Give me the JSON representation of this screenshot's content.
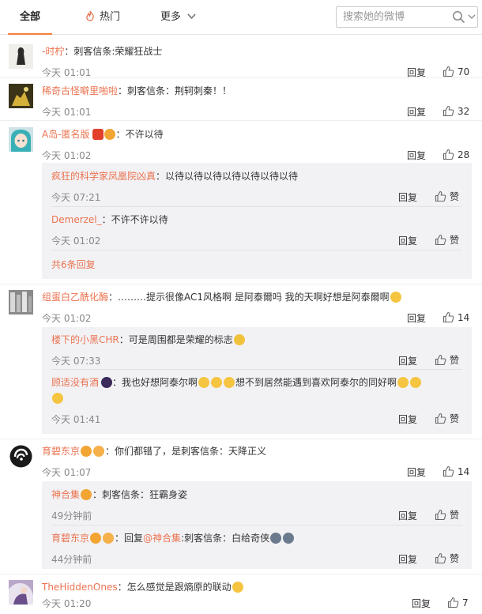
{
  "tabs": {
    "all": "全部",
    "hot": "热门",
    "more": "更多"
  },
  "search": {
    "placeholder": "搜索她的微博"
  },
  "comments": [
    {
      "user": "-时柠",
      "text": "刺客信条:荣耀狂战士",
      "time": "今天 01:01",
      "reply": "回复",
      "likes": "70"
    },
    {
      "user": "稀奇古怪噼里啪啦",
      "text": "刺客信条：荆轲刺秦！！",
      "time": "今天 01:01",
      "reply": "回复",
      "likes": "32"
    },
    {
      "user": "A岛-匿名版",
      "text": "不许以待",
      "time": "今天 01:02",
      "reply": "回复",
      "likes": "28",
      "subs": [
        {
          "user": "疯狂的科学家凤凰院凶真",
          "text": "以待以待以待以待以待以待以待",
          "time": "今天 07:21",
          "reply": "回复",
          "like_label": "赞"
        },
        {
          "user": "Demerzel_",
          "text": "不许不许以待",
          "time": "今天 01:02",
          "reply": "回复",
          "like_label": "赞"
        }
      ],
      "more": "共6条回复"
    },
    {
      "user": "组蛋白乙酰化酶",
      "text": "………提示很像AC1风格啊  是阿泰爾吗 我的天啊好想是阿泰爾啊",
      "time": "今天 01:02",
      "reply": "回复",
      "likes": "14",
      "subs": [
        {
          "user": "楼下的小黑CHR",
          "text": "可是周围都是荣耀的标志",
          "time": "今天 07:33",
          "reply": "回复",
          "like_label": "赞"
        },
        {
          "user": "顾适没有酒",
          "text": "我也好想阿泰尔啊",
          "text2": "想不到居然能遇到喜欢阿泰尔的同好啊",
          "time": "今天 01:41",
          "reply": "回复",
          "like_label": "赞"
        }
      ]
    },
    {
      "user": "育碧东京",
      "text": "你们都错了，是刺客信条：天降正义",
      "time": "今天 01:07",
      "reply": "回复",
      "likes": "14",
      "subs": [
        {
          "user": "神合集",
          "text": "刺客信条：狂霸身姿",
          "time": "49分钟前",
          "reply": "回复",
          "like_label": "赞"
        },
        {
          "user": "育碧东京",
          "text_prefix": "回复",
          "mention": "@神合集",
          "text": ":刺客信条：白给奇侠",
          "time": "44分钟前",
          "reply": "回复",
          "like_label": "赞"
        }
      ]
    },
    {
      "user": "TheHiddenOnes",
      "text": "怎么感觉是跟熵原的联动",
      "time": "今天 01:20",
      "reply": "回复",
      "likes": "7"
    }
  ],
  "colors": {
    "username": "#eb7350",
    "accent": "#fa7d3c",
    "subbox": "#f2f2f5",
    "time": "#888888"
  },
  "icons": [
    "fire-icon",
    "chevron-down-icon",
    "search-icon",
    "thumbs-up-icon",
    "verified-badge-icon",
    "emoji-icon"
  ]
}
